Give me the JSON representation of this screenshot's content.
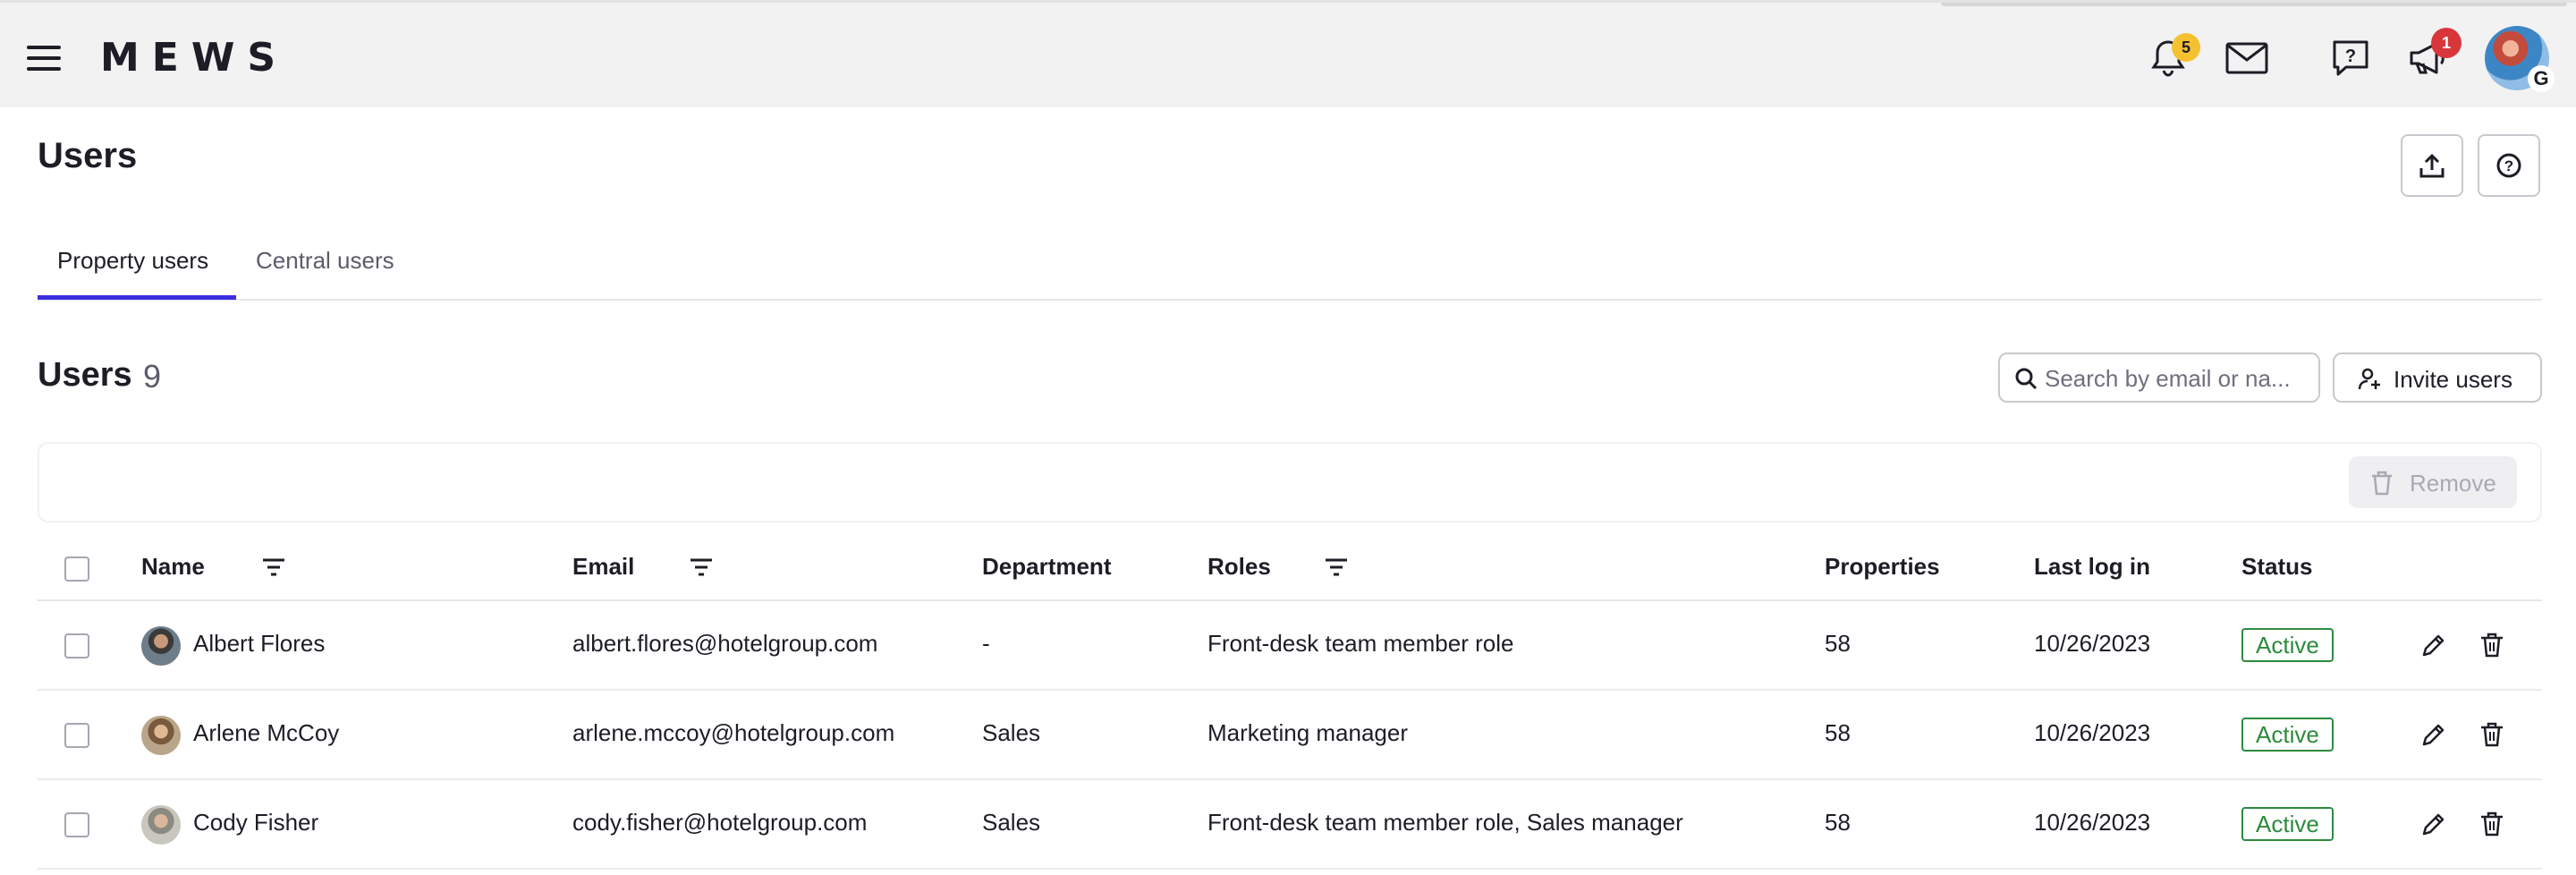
{
  "topbar": {
    "logo": "MEWS",
    "notifications_count": "5",
    "announcements_count": "1",
    "avatar_initial": "G",
    "icons": [
      "menu-icon",
      "bell-icon",
      "mail-icon",
      "help-chat-icon",
      "megaphone-icon"
    ]
  },
  "page": {
    "title": "Users"
  },
  "tabs": [
    {
      "label": "Property users",
      "active": true
    },
    {
      "label": "Central users",
      "active": false
    }
  ],
  "section": {
    "title": "Users",
    "count": "9",
    "search_placeholder": "Search by email or na...",
    "invite_label": "Invite users",
    "remove_label": "Remove"
  },
  "table": {
    "headers": {
      "name": "Name",
      "email": "Email",
      "department": "Department",
      "roles": "Roles",
      "properties": "Properties",
      "last_log_in": "Last log in",
      "status": "Status"
    },
    "rows": [
      {
        "name": "Albert Flores",
        "email": "albert.flores@hotelgroup.com",
        "department": "-",
        "roles": "Front-desk team member role",
        "properties": "58",
        "last_log_in": "10/26/2023",
        "status": "Active"
      },
      {
        "name": "Arlene McCoy",
        "email": "arlene.mccoy@hotelgroup.com",
        "department": "Sales",
        "roles": "Marketing manager",
        "properties": "58",
        "last_log_in": "10/26/2023",
        "status": "Active"
      },
      {
        "name": "Cody Fisher",
        "email": "cody.fisher@hotelgroup.com",
        "department": "Sales",
        "roles": "Front-desk team member role, Sales manager",
        "properties": "58",
        "last_log_in": "10/26/2023",
        "status": "Active"
      }
    ]
  },
  "colors": {
    "accent": "#3b2fe0",
    "status_active": "#2c8b3c",
    "badge_yellow": "#f5c131",
    "badge_red": "#d8363a",
    "topbar_bg": "#f2f2f2"
  }
}
